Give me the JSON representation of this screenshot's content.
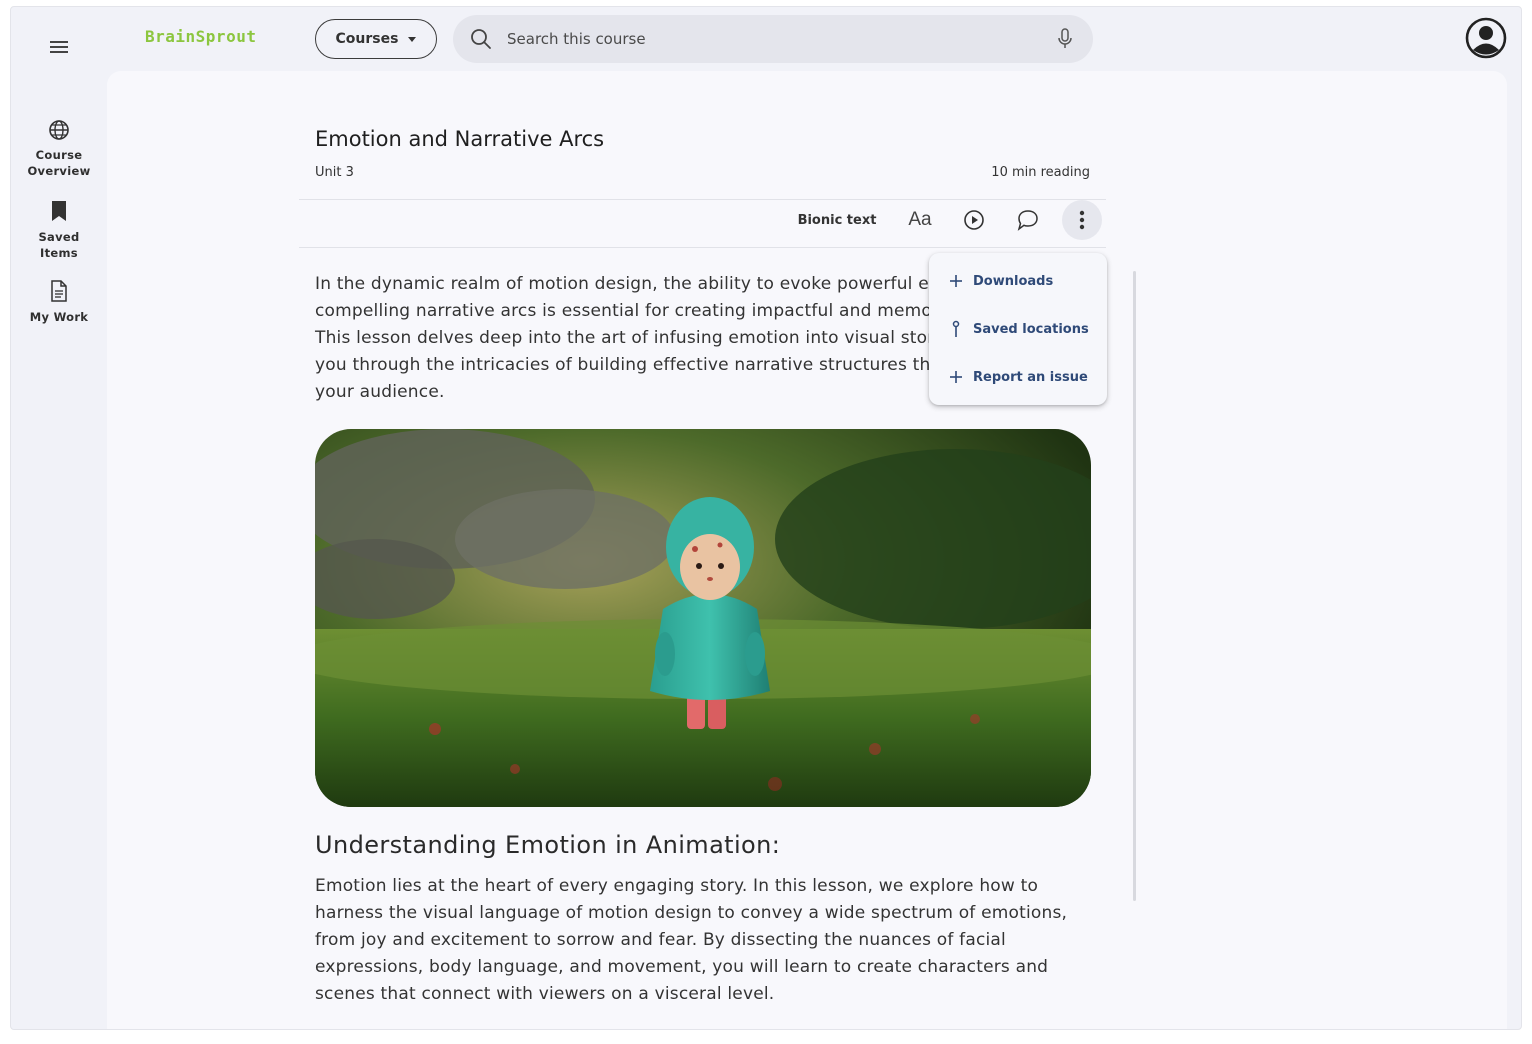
{
  "app": {
    "brand": "BrainSprout",
    "courses_label": "Courses",
    "search_placeholder": "Search this course"
  },
  "rail": {
    "items": [
      {
        "label": "Course Overview",
        "icon": "globe-icon"
      },
      {
        "label": "Saved Items",
        "icon": "bookmark-icon"
      },
      {
        "label": "My Work",
        "icon": "document-icon"
      }
    ]
  },
  "lesson": {
    "title": "Emotion and Narrative Arcs",
    "unit": "Unit 3",
    "read_time": "10 min reading",
    "paragraph1": "In the dynamic realm of motion design, the ability to evoke powerful emotions and craft compelling narrative arcs is essential for creating impactful and memorable animations. This lesson delves deep into the art of infusing emotion into visual storytelling, guiding you through the intricacies of building effective narrative structures that resonate with your audience.",
    "section_heading": "Understanding Emotion in Animation:",
    "paragraph2": "Emotion lies at the heart of every engaging story. In this lesson, we explore how to harness the visual language of motion design to convey a wide spectrum of emotions, from joy and excitement to sorrow and fear. By dissecting the nuances of facial expressions, body language, and movement, you will learn to create characters and scenes that connect with viewers on a visceral level."
  },
  "toolbar": {
    "bionic_label": "Bionic text",
    "font_label": "Aa"
  },
  "menu": {
    "items": [
      {
        "label": "Downloads",
        "icon": "plus-icon"
      },
      {
        "label": "Saved locations",
        "icon": "pin-icon"
      },
      {
        "label": "Report an issue",
        "icon": "plus-icon"
      }
    ]
  },
  "colors": {
    "brand": "#8cc63f",
    "menu_text": "#2f4a78",
    "panel_bg": "#f8f8fc",
    "app_bg": "#f1f2f8"
  }
}
